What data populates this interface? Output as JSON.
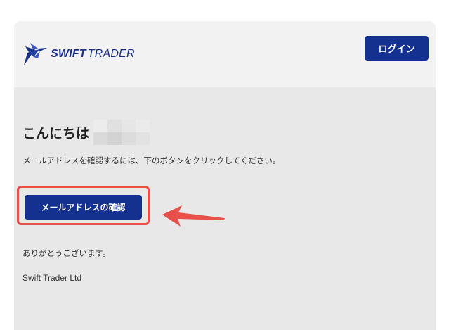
{
  "header": {
    "brand_bold": "SWIFT",
    "brand_light": "TRADER",
    "logo_icon": "bird-logo-icon",
    "login_label": "ログイン"
  },
  "email": {
    "greeting": "こんにちは",
    "recipient_name_redacted": true,
    "instruction": "メールアドレスを確認するには、下のボタンをクリックしてください。",
    "confirm_label": "メールアドレスの確認",
    "thanks": "ありがとうございます。",
    "company": "Swift Trader Ltd"
  },
  "annotation": {
    "highlight_color": "#e8504a",
    "arrow_icon": "left-arrow-icon"
  },
  "colors": {
    "brand": "#14318f",
    "header_bg": "#f2f2f2",
    "body_bg": "#e8e8e8"
  }
}
